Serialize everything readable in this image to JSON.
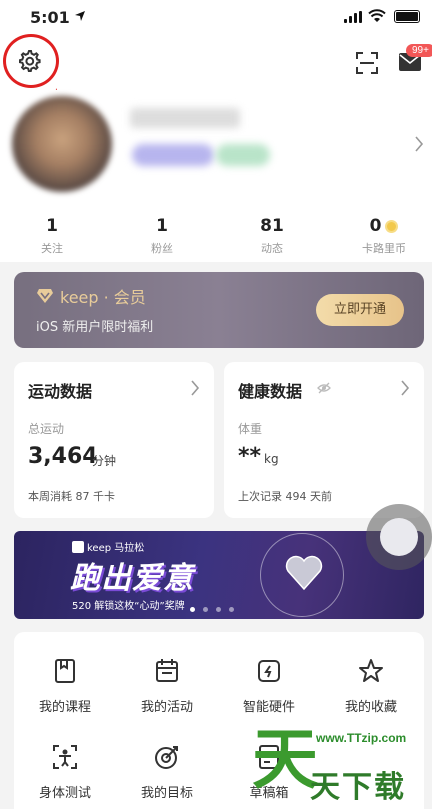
{
  "status_bar": {
    "time": "5:01"
  },
  "header": {
    "mail_badge": "99+"
  },
  "stats": [
    {
      "value": "1",
      "label": "关注"
    },
    {
      "value": "1",
      "label": "粉丝"
    },
    {
      "value": "81",
      "label": "动态"
    },
    {
      "value": "0",
      "label": "卡路里币"
    }
  ],
  "vip": {
    "brand": "keep · 会员",
    "subtitle": "iOS 新用户限时福利",
    "button": "立即开通"
  },
  "sport_card": {
    "title": "运动数据",
    "sub_label": "总运动",
    "value": "3,464",
    "unit": "分钟",
    "footer": "本周消耗 87 千卡"
  },
  "health_card": {
    "title": "健康数据",
    "sub_label": "体重",
    "value": "**",
    "unit": "kg",
    "footer": "上次记录 494 天前"
  },
  "banner": {
    "brand": "keep 马拉松",
    "title": "跑出爱意",
    "subtitle": "520 解锁这枚“心动”奖牌"
  },
  "grid": [
    {
      "label": "我的课程",
      "icon": "bookmark-icon"
    },
    {
      "label": "我的活动",
      "icon": "calendar-icon"
    },
    {
      "label": "智能硬件",
      "icon": "device-icon"
    },
    {
      "label": "我的收藏",
      "icon": "star-icon"
    },
    {
      "label": "身体测试",
      "icon": "body-test-icon"
    },
    {
      "label": "我的目标",
      "icon": "target-icon"
    },
    {
      "label": "草稿箱",
      "icon": "draft-icon"
    }
  ],
  "watermark": {
    "char": "天",
    "url": "www.TTzip.com",
    "text": "天下载"
  },
  "colors": {
    "annotation": "#e02020",
    "vip_gold": "#e8cc9a",
    "badge": "#f25757"
  }
}
